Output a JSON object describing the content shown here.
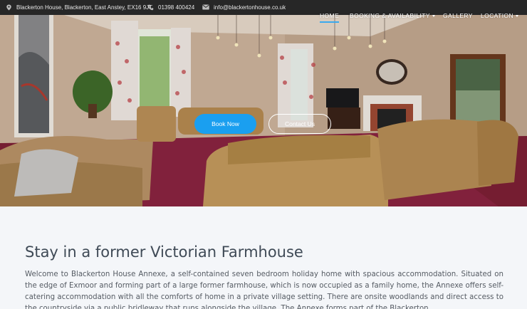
{
  "topbar": {
    "address": "Blackerton House, Blackerton, East Anstey, EX16 9JT",
    "phone": "01398 400424",
    "email": "info@blackertonhouse.co.uk",
    "icons": [
      "location-pin-icon",
      "phone-icon",
      "envelope-icon"
    ]
  },
  "nav": {
    "home": "HOME",
    "booking": "BOOKING & AVAILABILITY",
    "gallery": "GALLERY",
    "location": "LOCATION"
  },
  "hero": {
    "book_label": "Book Now",
    "contact_label": "Contact Us"
  },
  "content": {
    "heading": "Stay in a former Victorian Farmhouse",
    "intro": "Welcome to Blackerton House Annexe, a self-contained seven bedroom holiday home with spacious accommodation. Situated on the edge of Exmoor and forming part of a large former farmhouse, which is now occupied as a family home, the Annexe offers self-catering accommodation with all the comforts of home in a private village setting. There are onsite woodlands and direct access to the countryside via a public bridleway that runs alongside the village. The Annexe forms part of the Blackerton"
  },
  "colors": {
    "topbar_bg": "#272727",
    "accent": "#1a9ff0",
    "carpet": "#7d1f35",
    "heading": "#3f4a56"
  }
}
